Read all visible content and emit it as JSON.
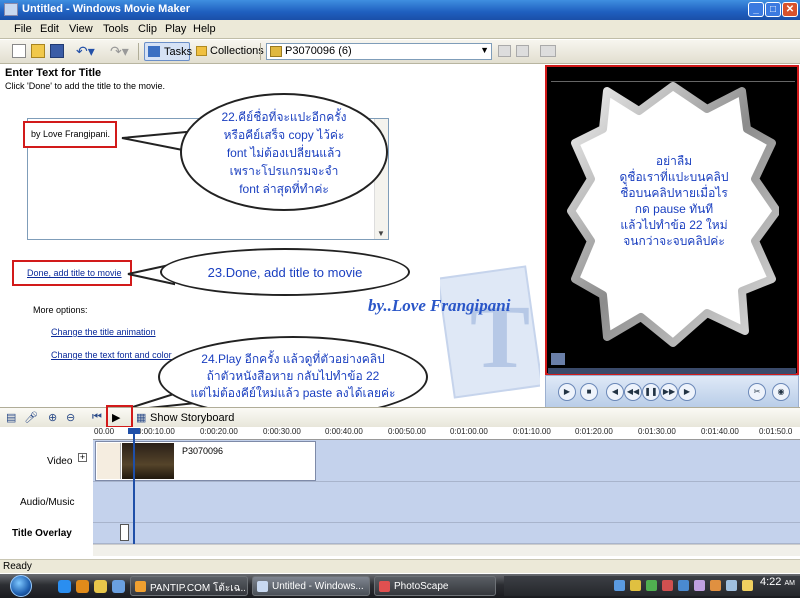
{
  "window": {
    "title": "Untitled - Windows Movie Maker"
  },
  "menu": [
    "File",
    "Edit",
    "View",
    "Tools",
    "Clip",
    "Play",
    "Help"
  ],
  "toolbar": {
    "tasks_label": "Tasks",
    "collections_label": "Collections",
    "collection_value": "P3070096 (6)"
  },
  "task_pane": {
    "heading": "Enter Text for Title",
    "instruction": "Click 'Done' to add the title to the movie.",
    "title_text": "by Love Frangipani.",
    "done_link": "Done, add title to movie",
    "more_options": "More options:",
    "link_animation": "Change the title animation",
    "link_font": "Change the text font and color"
  },
  "callouts": {
    "c22": [
      "22.คีย์ชื่อที่จะแปะอีกครั้ง",
      "หรือคีย์เสร็จ copy ไว้ค่ะ",
      "font ไม่ต้องเปลี่ยนแล้ว",
      "เพราะโปรแกรมจะจำ",
      "font ล่าสุดที่ทำค่ะ"
    ],
    "c23": "23.Done, add title to movie",
    "c24": [
      "24.Play อีกครั้ง แล้วดูที่ตัวอย่างคลิป",
      "ถ้าตัวหนังสือหาย กลับไปทำข้อ 22",
      "แต่ไม่ต้องคีย์ใหม่แล้ว paste ลงได้เลยค่ะ"
    ]
  },
  "watermark": "by..Love Frangipani",
  "preview_note": [
    "อย่าลืม",
    "ดูชื่อเราที่แปะบนคลิป",
    "ชื่อบนคลิปหายเมื่อไร",
    "กด pause ทันที",
    "แล้วไปทำข้อ 22 ใหม่",
    "จนกว่าจะจบคลิปค่ะ"
  ],
  "timeline": {
    "storyboard_label": "Show Storyboard",
    "ruler": [
      "00.00",
      "0:00:10.00",
      "0:00:20.00",
      "0:00:30.00",
      "0:00:40.00",
      "0:00:50.00",
      "0:01:00.00",
      "0:01:10.00",
      "0:01:20.00",
      "0:01:30.00",
      "0:01:40.00",
      "0:01:50.0"
    ],
    "tracks": {
      "video": "Video",
      "audio": "Audio/Music",
      "title": "Title Overlay"
    },
    "clip_name": "P3070096"
  },
  "status": "Ready",
  "taskbar": {
    "items": [
      "PANTIP.COM โต้ะเฉ...",
      "Untitled - Windows...",
      "PhotoScape"
    ],
    "clock": "4:22",
    "clock_ampm": "AM"
  },
  "colors": {
    "accent_red": "#d21a1a",
    "callout_text": "#1a3fc0",
    "link": "#0a2a9a"
  }
}
